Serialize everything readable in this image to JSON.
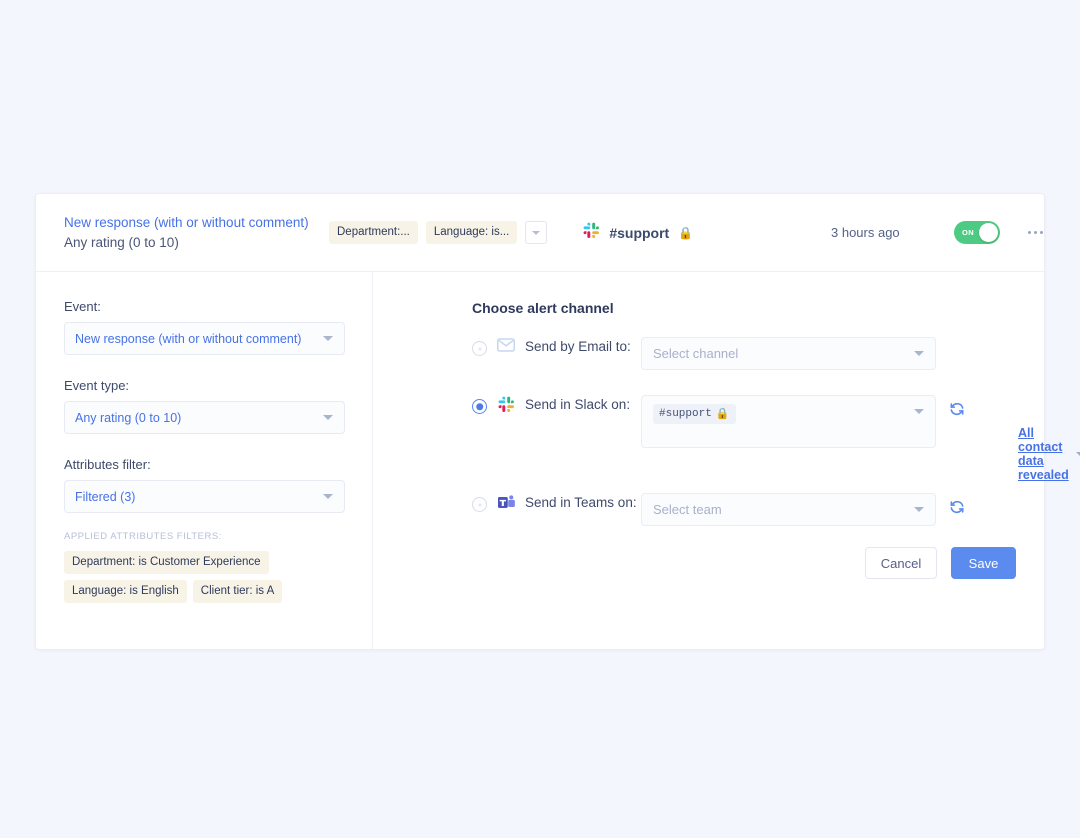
{
  "theme": {
    "page_bg": "#f4f6fd",
    "accent_blue": "#4772e6",
    "save_blue": "#5b8bef",
    "toggle_green": "#4ecb82",
    "chip_beige": "#f7f3e6"
  },
  "header": {
    "title": "New response (with or without comment)",
    "subtitle": "Any rating (0 to 10)",
    "chips": [
      {
        "label": "Department:..."
      },
      {
        "label": "Language: is..."
      }
    ],
    "more_chips_icon": "chevron-down-icon",
    "channel_icon": "slack-icon",
    "channel_name": "#support",
    "channel_lock": "🔒",
    "timestamp": "3 hours ago",
    "toggle": {
      "label": "ON",
      "state": "on"
    },
    "menu_icon": "kebab-menu-icon"
  },
  "left_pane": {
    "event_label": "Event:",
    "event_value": "New response (with or without comment)",
    "event_type_label": "Event type:",
    "event_type_value": "Any rating (0 to 10)",
    "attributes_filter_label": "Attributes filter:",
    "attributes_filter_value": "Filtered (3)",
    "applied_filters_label": "APPLIED ATTRIBUTES FILTERS:",
    "applied_filters": [
      "Department: is Customer Experience",
      "Language: is English",
      "Client tier: is A"
    ]
  },
  "right_pane": {
    "section_title": "Choose alert channel",
    "channels": [
      {
        "id": "email",
        "icon": "envelope-icon",
        "label": "Send by Email to:",
        "selected": false,
        "placeholder": "Select channel",
        "value": "",
        "has_refresh": false
      },
      {
        "id": "slack",
        "icon": "slack-icon",
        "label": "Send in Slack on:",
        "selected": true,
        "placeholder": "",
        "value": "#support",
        "token_lock": "🔒",
        "has_refresh": true,
        "refresh_icon": "refresh-icon"
      },
      {
        "id": "teams",
        "icon": "teams-icon",
        "label": "Send in Teams on:",
        "selected": false,
        "placeholder": "Select team",
        "value": "",
        "has_refresh": true,
        "refresh_icon": "refresh-icon"
      }
    ],
    "reveal_link": "All contact data revealed",
    "reveal_caret_icon": "chevron-down-icon",
    "cancel_label": "Cancel",
    "save_label": "Save"
  }
}
